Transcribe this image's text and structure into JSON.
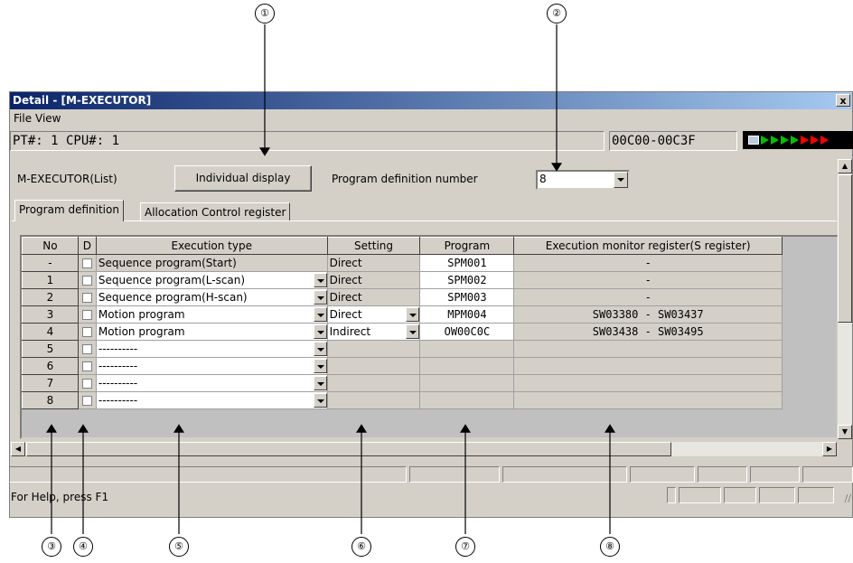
{
  "callouts": [
    "①",
    "②",
    "③",
    "④",
    "⑤",
    "⑥",
    "⑦",
    "⑧"
  ],
  "window": {
    "title": "Detail - [M-EXECUTOR]",
    "close": "x"
  },
  "menu": {
    "file": "File",
    "view": "View"
  },
  "info": {
    "pt_cpu": "PT#: 1 CPU#: 1",
    "address": "00C00-00C3F"
  },
  "toolbar": {
    "mode_label": "M-EXECUTOR(List)",
    "individual_button": "Individual display",
    "def_number_label": "Program definition number",
    "def_number_value": "8"
  },
  "tabs": [
    "Program definition",
    "Allocation Control register"
  ],
  "grid": {
    "headers": [
      "No",
      "D",
      "Execution type",
      "Setting",
      "Program",
      "Execution monitor register(S register)"
    ],
    "rows": [
      {
        "no": "-",
        "type": "Sequence program(Start)",
        "setting": "Direct",
        "program": "SPM001",
        "monitor": "-"
      },
      {
        "no": "1",
        "type": "Sequence program(L-scan)",
        "setting": "Direct",
        "program": "SPM002",
        "monitor": "-"
      },
      {
        "no": "2",
        "type": "Sequence program(H-scan)",
        "setting": "Direct",
        "program": "SPM003",
        "monitor": "-"
      },
      {
        "no": "3",
        "type": "Motion program",
        "setting": "Direct",
        "program": "MPM004",
        "monitor": "SW03380 - SW03437"
      },
      {
        "no": "4",
        "type": "Motion program",
        "setting": "Indirect",
        "program": "OW00C0C",
        "monitor": "SW03438 - SW03495"
      },
      {
        "no": "5",
        "type": "----------",
        "setting": "",
        "program": "",
        "monitor": ""
      },
      {
        "no": "6",
        "type": "----------",
        "setting": "",
        "program": "",
        "monitor": ""
      },
      {
        "no": "7",
        "type": "----------",
        "setting": "",
        "program": "",
        "monitor": ""
      },
      {
        "no": "8",
        "type": "----------",
        "setting": "",
        "program": "",
        "monitor": ""
      }
    ]
  },
  "status": {
    "help": "For Help, press F1"
  },
  "colors": {
    "title_start": "#0a246a",
    "title_end": "#a6caf0",
    "face": "#d4d0c8",
    "led_green": "#00c000",
    "led_red": "#ff0000"
  }
}
